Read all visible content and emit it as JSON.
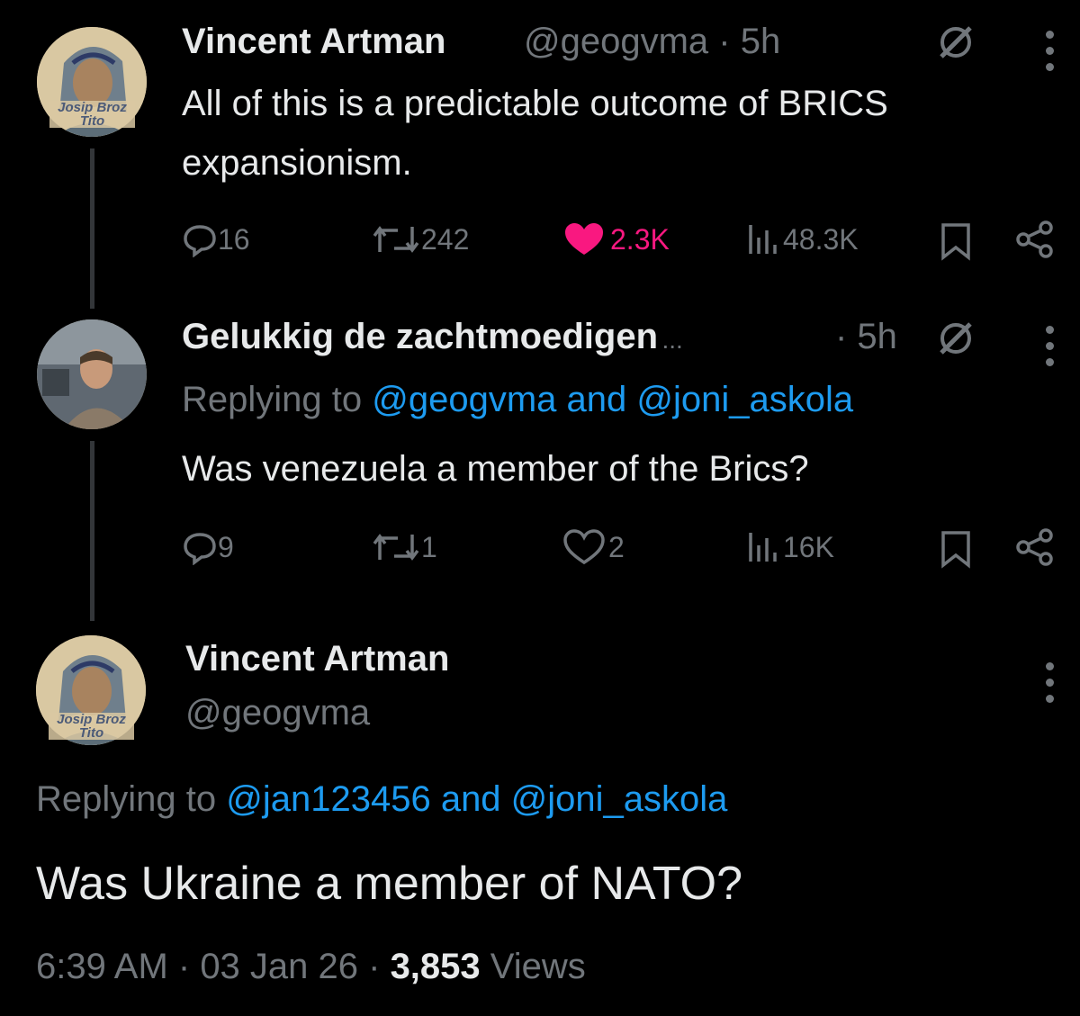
{
  "tweets": [
    {
      "avatar_caption": "Josip Broz\nTito",
      "name": "Vincent Artman",
      "handle": "@geogvma",
      "separator": " · ",
      "time": "5h",
      "text_line1": "All of this is a predictable outcome of BRICS",
      "text_line2": "expansionism.",
      "replies": "16",
      "reposts": "242",
      "likes": "2.3K",
      "views": "48.3K"
    },
    {
      "name": "Gelukkig de zachtmoedigen",
      "ellipsis": "...",
      "time": "· 5h",
      "replying_prefix": "Replying to ",
      "replying_to_1": "@geogvma",
      "replying_and": " and ",
      "replying_to_2": "@joni_askola",
      "text": "Was venezuela a member of the Brics?",
      "replies": "9",
      "reposts": "1",
      "likes": "2",
      "views": "16K"
    }
  ],
  "main_tweet": {
    "avatar_caption": "Josip Broz\nTito",
    "name": "Vincent Artman",
    "handle": "@geogvma",
    "replying_prefix": "Replying to ",
    "replying_to_1": "@jan123456",
    "replying_and": " and ",
    "replying_to_2": "@joni_askola",
    "text": "Was Ukraine a member of NATO?",
    "time": "6:39 AM",
    "sep1": " · ",
    "date": "03 Jan 26",
    "sep2": " · ",
    "views_count": "3,853",
    "views_label": " Views"
  },
  "colors": {
    "accent": "#1d9bf0",
    "like": "#f91880",
    "muted": "#71767b",
    "text": "#e7e9ea"
  }
}
